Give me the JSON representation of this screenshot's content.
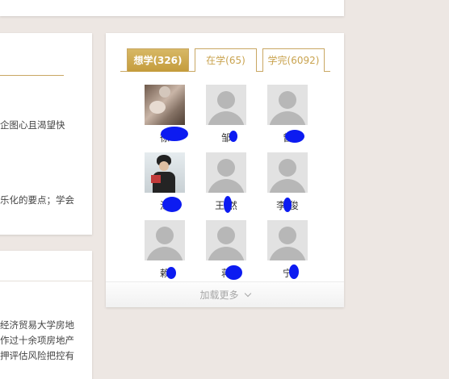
{
  "left_panel_1": {
    "line1": "企图心且渴望快",
    "line2": "乐化的要点；学会"
  },
  "left_panel_2": {
    "line1": "经济贸易大学房地",
    "line2": "作过十余项房地产",
    "line3": "押评估风险把控有"
  },
  "tabs": [
    {
      "label": "想学(326)",
      "active": true
    },
    {
      "label": "在学(65)",
      "active": false
    },
    {
      "label": "学完(6092)",
      "active": false
    }
  ],
  "users": [
    {
      "name": "徐",
      "avatar": "cat-photo"
    },
    {
      "name": "邹",
      "avatar": "default-avatar"
    },
    {
      "name": "曾",
      "avatar": "default-avatar"
    },
    {
      "name": "涂",
      "avatar": "man-photo"
    },
    {
      "name": "王  然",
      "avatar": "default-avatar"
    },
    {
      "name": "李  俊",
      "avatar": "default-avatar"
    },
    {
      "name": "赖",
      "avatar": "default-avatar"
    },
    {
      "name": "蒋",
      "avatar": "default-avatar"
    },
    {
      "name": "宁",
      "avatar": "default-avatar"
    }
  ],
  "load_more": {
    "label": "加载更多"
  }
}
